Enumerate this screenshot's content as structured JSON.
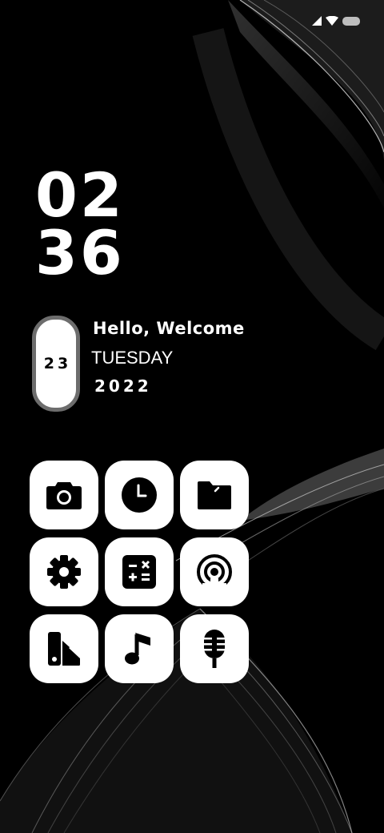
{
  "status_bar": {
    "icons": [
      "signal-icon",
      "wifi-icon",
      "battery-icon"
    ]
  },
  "clock": {
    "hour": "02",
    "minute": "36"
  },
  "date_widget": {
    "day": "23",
    "greeting": "Hello, Welcome",
    "weekday": "TUESDAY",
    "year": "2022"
  },
  "apps": [
    {
      "name": "camera-icon"
    },
    {
      "name": "clock-icon"
    },
    {
      "name": "folder-icon"
    },
    {
      "name": "settings-icon"
    },
    {
      "name": "calculator-icon"
    },
    {
      "name": "podcast-icon"
    },
    {
      "name": "theme-store-icon"
    },
    {
      "name": "music-icon"
    },
    {
      "name": "voice-recorder-icon"
    }
  ],
  "colors": {
    "background": "#000000",
    "icon_tile": "#ffffff",
    "pill_border": "#6d6d6d"
  }
}
